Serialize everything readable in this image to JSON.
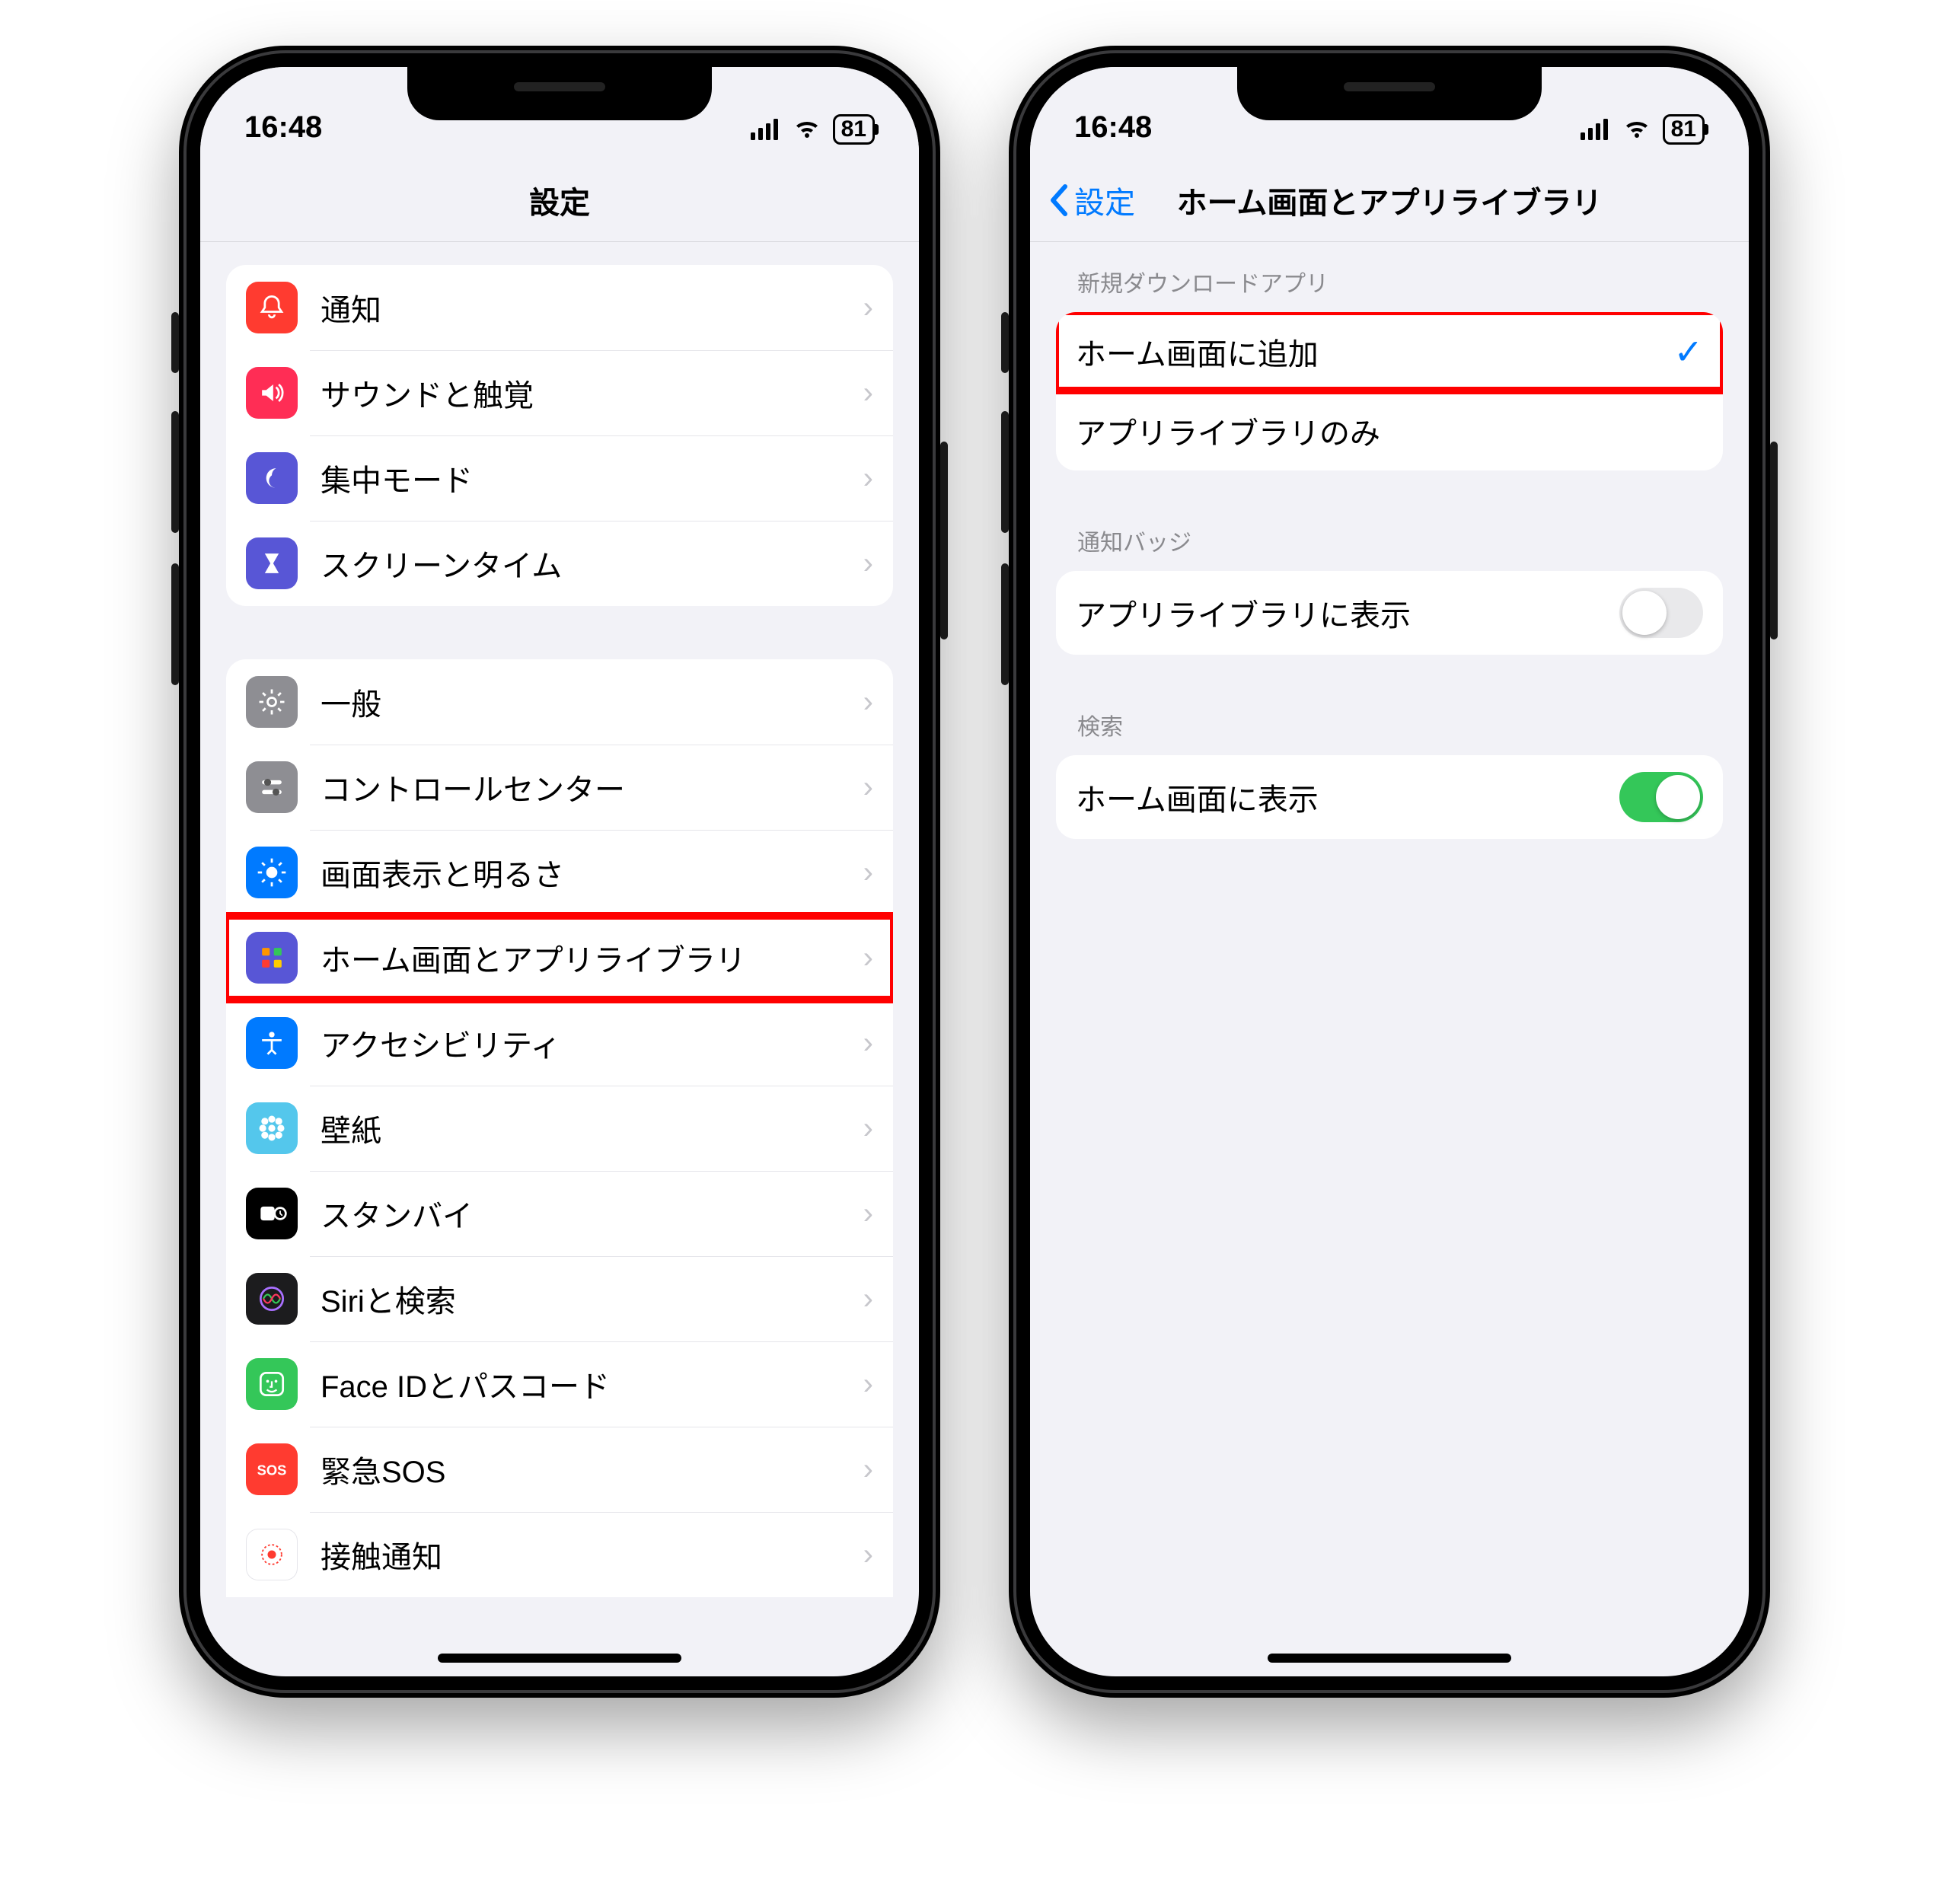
{
  "status": {
    "time": "16:48",
    "battery": "81"
  },
  "left": {
    "nav_title": "設定",
    "group1": [
      {
        "label": "通知",
        "icon": "bell",
        "bg": "#ff3b30"
      },
      {
        "label": "サウンドと触覚",
        "icon": "speaker",
        "bg": "#ff2d55"
      },
      {
        "label": "集中モード",
        "icon": "moon",
        "bg": "#5856d6"
      },
      {
        "label": "スクリーンタイム",
        "icon": "hourglass",
        "bg": "#5856d6"
      }
    ],
    "group2": [
      {
        "label": "一般",
        "icon": "gear",
        "bg": "#8e8e93"
      },
      {
        "label": "コントロールセンター",
        "icon": "sliders",
        "bg": "#8e8e93"
      },
      {
        "label": "画面表示と明るさ",
        "icon": "sun",
        "bg": "#007aff"
      },
      {
        "label": "ホーム画面とアプリライブラリ",
        "icon": "grid",
        "bg": "#5856d6",
        "highlight": true
      },
      {
        "label": "アクセシビリティ",
        "icon": "access",
        "bg": "#007aff"
      },
      {
        "label": "壁紙",
        "icon": "flower",
        "bg": "#54c7ec"
      },
      {
        "label": "スタンバイ",
        "icon": "standby",
        "bg": "#000000"
      },
      {
        "label": "Siriと検索",
        "icon": "siri",
        "bg": "#1c1c1e"
      },
      {
        "label": "Face IDとパスコード",
        "icon": "faceid",
        "bg": "#34c759"
      },
      {
        "label": "緊急SOS",
        "icon": "sos",
        "bg": "#ff3b30"
      },
      {
        "label": "接触通知",
        "icon": "exposure",
        "bg": "#ffffff"
      }
    ]
  },
  "right": {
    "back_label": "設定",
    "nav_title": "ホーム画面とアプリライブラリ",
    "section1_header": "新規ダウンロードアプリ",
    "section1_options": [
      {
        "label": "ホーム画面に追加",
        "selected": true,
        "highlight": true
      },
      {
        "label": "アプリライブラリのみ",
        "selected": false
      }
    ],
    "section2_header": "通知バッジ",
    "section2_row": {
      "label": "アプリライブラリに表示",
      "on": false
    },
    "section3_header": "検索",
    "section3_row": {
      "label": "ホーム画面に表示",
      "on": true
    }
  }
}
